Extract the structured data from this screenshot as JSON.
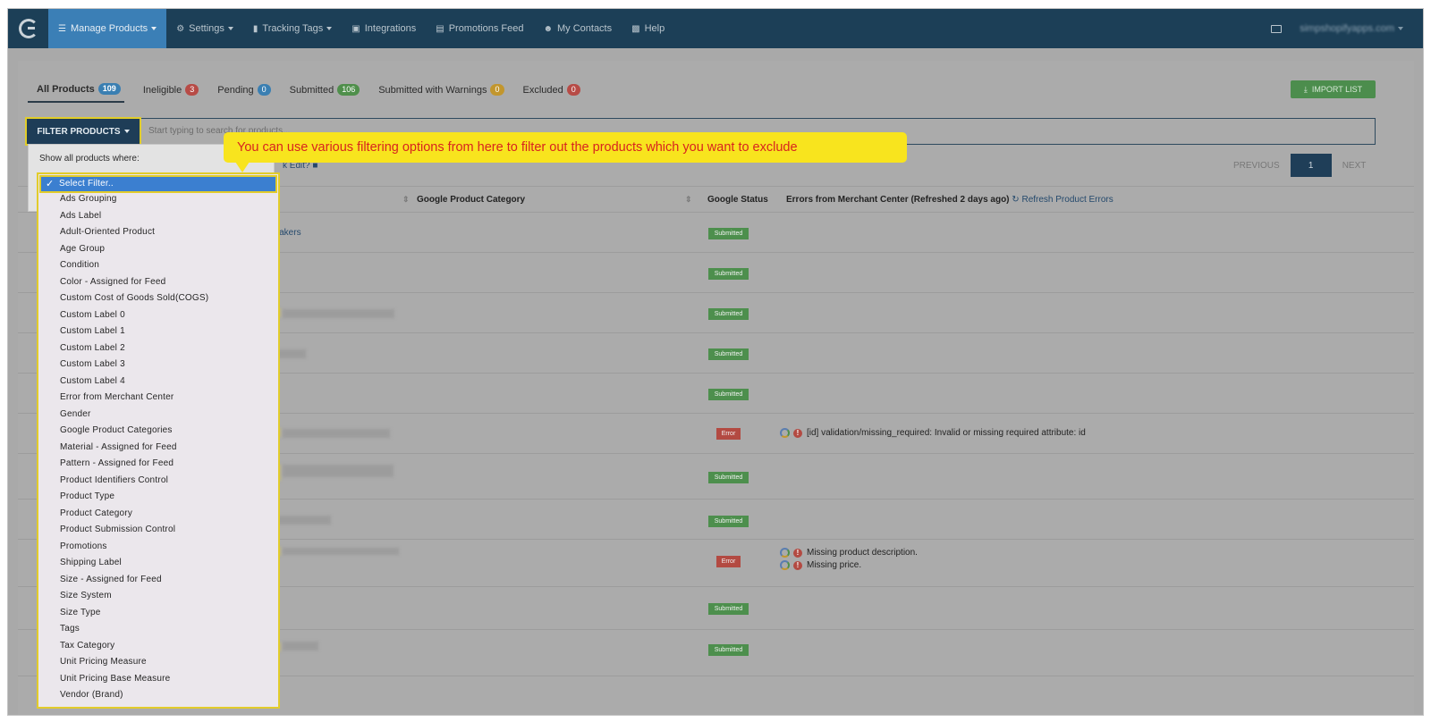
{
  "nav": {
    "items": [
      {
        "label": "Manage Products",
        "icon": "list-icon",
        "active": true
      },
      {
        "label": "Settings",
        "icon": "gear-icon"
      },
      {
        "label": "Tracking Tags",
        "icon": "bar-chart-icon"
      },
      {
        "label": "Integrations",
        "icon": "briefcase-icon"
      },
      {
        "label": "Promotions Feed",
        "icon": "document-icon"
      },
      {
        "label": "My Contacts",
        "icon": "users-icon"
      },
      {
        "label": "Help",
        "icon": "help-icon"
      }
    ],
    "account": "simpshopifyapps.com"
  },
  "tabs": [
    {
      "label": "All Products",
      "count": "109",
      "color": "#3a7fb2"
    },
    {
      "label": "Ineligible",
      "count": "3",
      "color": "#b74b46"
    },
    {
      "label": "Pending",
      "count": "0",
      "color": "#3a7fb2"
    },
    {
      "label": "Submitted",
      "count": "106",
      "color": "#4f8f4b"
    },
    {
      "label": "Submitted with Warnings",
      "count": "0",
      "color": "#c2962d"
    },
    {
      "label": "Excluded",
      "count": "0",
      "color": "#b74b46"
    }
  ],
  "import_button": "IMPORT LIST",
  "filter_button": "FILTER PRODUCTS",
  "search_placeholder": "Start typing to search for products...",
  "bulk_edit": "k Edit?",
  "pagination": {
    "previous": "PREVIOUS",
    "page": "1",
    "next": "NEXT"
  },
  "table": {
    "headers": {
      "category": "Google Product Category",
      "status": "Google Status",
      "errors": "Errors from Merchant Center (Refreshed 2 days ago)",
      "refresh": "Refresh Product Errors"
    },
    "first_product_fragment": "neakers",
    "statuses": [
      "Submitted",
      "Submitted",
      "Submitted",
      "Submitted",
      "Submitted",
      "Error",
      "Submitted",
      "Submitted",
      "Error",
      "Submitted",
      "Submitted"
    ],
    "errors": {
      "row6": [
        "[id] validation/missing_required: Invalid or missing required attribute: id"
      ],
      "row9": [
        "Missing product description.",
        "Missing price."
      ]
    }
  },
  "filter_popover": {
    "label": "Show all products where:",
    "close": "×",
    "options": [
      "Select Filter..",
      "Ads Grouping",
      "Ads Label",
      "Adult-Oriented Product",
      "Age Group",
      "Condition",
      "Color - Assigned for Feed",
      "Custom Cost of Goods Sold(COGS)",
      "Custom Label 0",
      "Custom Label 1",
      "Custom Label 2",
      "Custom Label 3",
      "Custom Label 4",
      "Error from Merchant Center",
      "Gender",
      "Google Product Categories",
      "Material - Assigned for Feed",
      "Pattern - Assigned for Feed",
      "Product Identifiers Control",
      "Product Type",
      "Product Category",
      "Product Submission Control",
      "Promotions",
      "Shipping Label",
      "Size - Assigned for Feed",
      "Size System",
      "Size Type",
      "Tags",
      "Tax Category",
      "Unit Pricing Measure",
      "Unit Pricing Base Measure",
      "Vendor (Brand)"
    ]
  },
  "callout": "You can use various filtering options from here to filter out the products which you want to exclude"
}
